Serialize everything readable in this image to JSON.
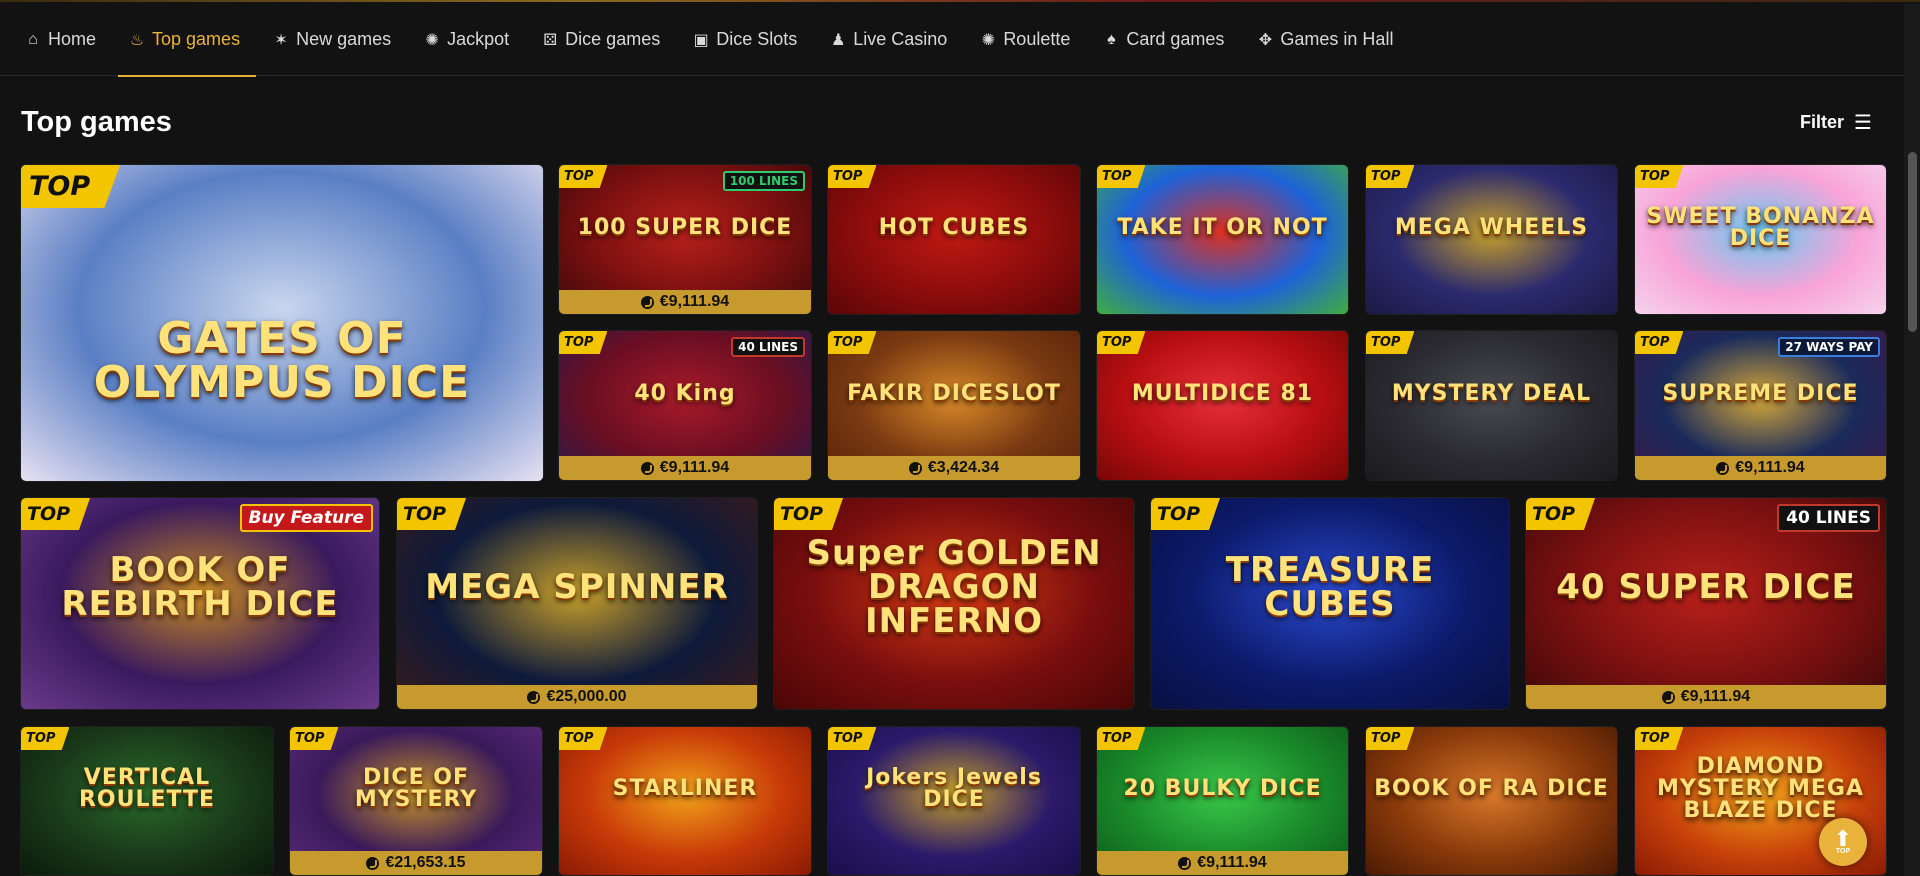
{
  "nav": {
    "items": [
      {
        "label": "Home",
        "icon": "home-icon",
        "glyph": "⌂"
      },
      {
        "label": "Top games",
        "icon": "flame-icon",
        "glyph": "♨",
        "active": true
      },
      {
        "label": "New games",
        "icon": "new-badge-icon",
        "glyph": "✶"
      },
      {
        "label": "Jackpot",
        "icon": "jackpot-chip-icon",
        "glyph": "✺"
      },
      {
        "label": "Dice games",
        "icon": "dice-icon",
        "glyph": "⚄"
      },
      {
        "label": "Dice Slots",
        "icon": "slot-machine-icon",
        "glyph": "▣"
      },
      {
        "label": "Live Casino",
        "icon": "person-icon",
        "glyph": "♟"
      },
      {
        "label": "Roulette",
        "icon": "roulette-icon",
        "glyph": "✺"
      },
      {
        "label": "Card games",
        "icon": "cards-icon",
        "glyph": "♠"
      },
      {
        "label": "Games in Hall",
        "icon": "move-arrows-icon",
        "glyph": "✥"
      }
    ]
  },
  "section": {
    "title": "Top games",
    "filter_label": "Filter",
    "filter_icon": "sliders-icon",
    "filter_glyph": "☰"
  },
  "badge": {
    "top_label": "TOP"
  },
  "games": [
    {
      "title": "GATES OF OLYMPUS DICE",
      "size": "big",
      "colors": [
        "#5a7fc4",
        "#c9d6ee",
        "#e7e1f2"
      ]
    },
    {
      "title": "100 SUPER DICE",
      "size": "small",
      "tag": "100 LINES",
      "tag_style": "green",
      "jackpot": "€9,111.94",
      "colors": [
        "#7a1010",
        "#b8201a",
        "#3a0808"
      ]
    },
    {
      "title": "HOT CUBES",
      "size": "small",
      "colors": [
        "#8c0c0c",
        "#c01a12",
        "#5a0606"
      ]
    },
    {
      "title": "TAKE IT OR NOT",
      "size": "small",
      "colors": [
        "#1e62d8",
        "#e0301f",
        "#3fae3f"
      ]
    },
    {
      "title": "MEGA WHEELS",
      "size": "small",
      "colors": [
        "#2b2a6e",
        "#c9a12a",
        "#1a1a44"
      ]
    },
    {
      "title": "SWEET BONANZA DICE",
      "size": "small",
      "colors": [
        "#f8a4d8",
        "#68c8f0",
        "#f6d2ec"
      ]
    },
    {
      "title": "40 King",
      "size": "small",
      "tag": "40 LINES",
      "jackpot": "€9,111.94",
      "colors": [
        "#6a0e22",
        "#a81a2a",
        "#2a1a4a"
      ]
    },
    {
      "title": "FAKIR DICESLOT",
      "size": "small",
      "jackpot": "€3,424.34",
      "colors": [
        "#7a3a12",
        "#d98a28",
        "#5a2208"
      ]
    },
    {
      "title": "MULTIDICE 81",
      "size": "small",
      "colors": [
        "#b80f12",
        "#e8303a",
        "#7a0606"
      ]
    },
    {
      "title": "MYSTERY DEAL",
      "size": "small",
      "colors": [
        "#2a2a30",
        "#4a4a52",
        "#1a1a1e"
      ]
    },
    {
      "title": "SUPREME DICE",
      "size": "small",
      "tag": "27 WAYS PAY",
      "tag_style": "blue",
      "jackpot": "€9,111.94",
      "colors": [
        "#1a2a5a",
        "#d6a83a",
        "#3a1a4a"
      ]
    },
    {
      "title": "BOOK OF REBIRTH DICE",
      "size": "medium",
      "tag": "Buy Feature",
      "tag_style": "red-fill",
      "colors": [
        "#3a1a5e",
        "#c88a22",
        "#6a3a8a"
      ]
    },
    {
      "title": "MEGA SPINNER",
      "size": "medium",
      "jackpot": "€25,000.00",
      "colors": [
        "#0e1a3a",
        "#c9a02a",
        "#3a1a1a"
      ]
    },
    {
      "title": "Super GOLDEN DRAGON INFERNO",
      "size": "medium",
      "colors": [
        "#7a0e0e",
        "#d43a12",
        "#4a0606"
      ]
    },
    {
      "title": "TREASURE CUBES",
      "size": "medium",
      "colors": [
        "#0c1a6a",
        "#2a4ad0",
        "#081040"
      ]
    },
    {
      "title": "40 SUPER DICE",
      "size": "medium",
      "tag": "40 LINES",
      "jackpot": "€9,111.94",
      "colors": [
        "#7a1010",
        "#b8201a",
        "#3a0808"
      ]
    },
    {
      "title": "VERTICAL ROULETTE",
      "size": "small",
      "colors": [
        "#1a3a1a",
        "#2a6a2a",
        "#0a1a0a"
      ]
    },
    {
      "title": "DICE OF MYSTERY",
      "size": "small",
      "jackpot": "€21,653.15",
      "colors": [
        "#3a1a5a",
        "#c8922a",
        "#5a2a7a"
      ]
    },
    {
      "title": "STARLINER",
      "size": "small",
      "colors": [
        "#c83a08",
        "#f2a21a",
        "#8a1a04"
      ]
    },
    {
      "title": "Jokers Jewels DICE",
      "size": "small",
      "colors": [
        "#2a1a6a",
        "#c8a02a",
        "#1a0e4a"
      ]
    },
    {
      "title": "20 BULKY DICE",
      "size": "small",
      "jackpot": "€9,111.94",
      "colors": [
        "#1a8a2a",
        "#3ac84a",
        "#0e5a1a"
      ]
    },
    {
      "title": "BOOK OF RA DICE",
      "size": "small",
      "colors": [
        "#8a3a0a",
        "#d8782a",
        "#4a1a04"
      ]
    },
    {
      "title": "DIAMOND MYSTERY MEGA BLAZE DICE",
      "size": "small",
      "colors": [
        "#c8420a",
        "#f2a21a",
        "#8a1a04"
      ]
    }
  ],
  "to_top": {
    "label": "TOP",
    "icon": "arrow-up-icon"
  }
}
